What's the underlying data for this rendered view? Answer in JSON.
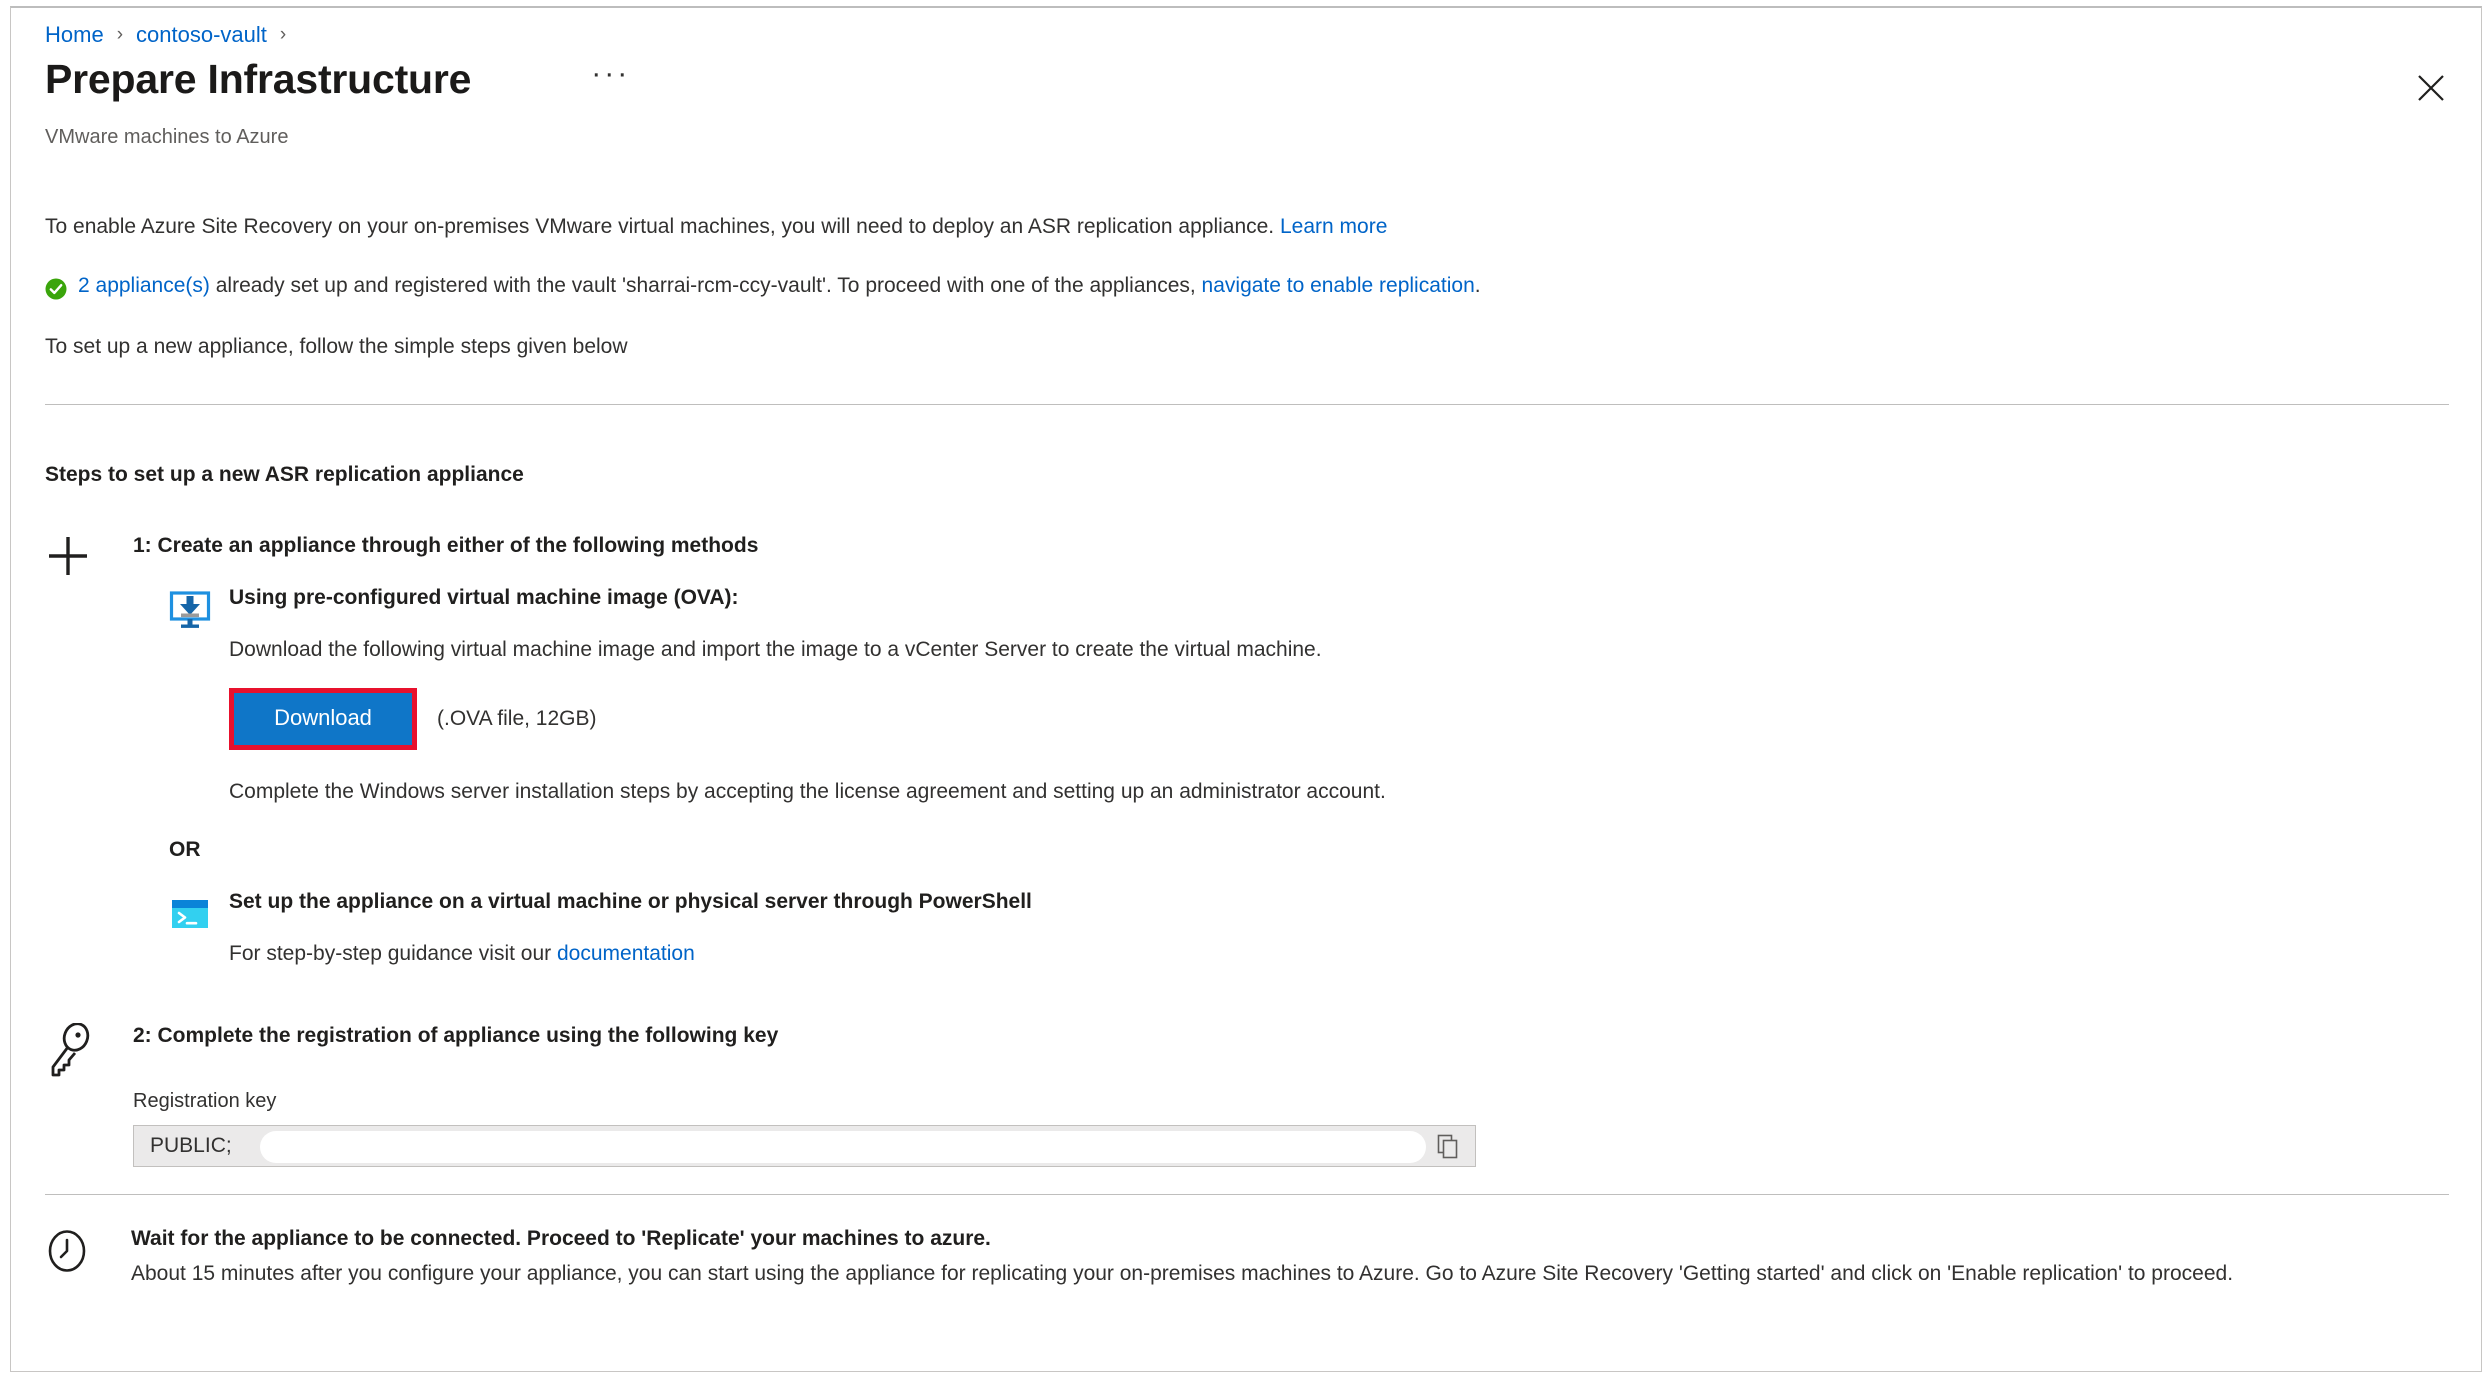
{
  "breadcrumb": {
    "items": [
      {
        "label": "Home"
      },
      {
        "label": "contoso-vault"
      }
    ],
    "separator": "›"
  },
  "header": {
    "title": "Prepare Infrastructure",
    "subtitle": "VMware machines to Azure",
    "more_label": "···",
    "close_label": "",
    "more_icon": "ellipsis-icon",
    "close_icon": "close-icon"
  },
  "intro": {
    "line1_pre": "To enable Azure Site Recovery on your on-premises VMware virtual machines, you will need to deploy an ASR replication appliance. ",
    "line1_link": "Learn more",
    "status_icon": "success-check-icon",
    "status_link1": "2 appliance(s)",
    "status_mid": " already set up and registered with the vault 'sharrai-rcm-ccy-vault'. To proceed with one of the appliances, ",
    "status_link2": "navigate to enable replication",
    "status_end": ".",
    "hint": "To set up a new appliance, follow the simple steps given below"
  },
  "steps": {
    "heading": "Steps to set up a new ASR replication appliance",
    "step1": {
      "icon": "plus-icon",
      "title": "1: Create an appliance through either of the following methods",
      "ova": {
        "icon": "monitor-download-icon",
        "title": "Using pre-configured virtual machine image (OVA):",
        "text": "Download the following virtual machine image and import the image to a vCenter Server to create the virtual machine.",
        "download_label": "Download",
        "download_note": "(.OVA file, 12GB)",
        "post_text": "Complete the Windows server installation steps by accepting the license agreement and setting up an administrator account.",
        "highlight_color": "#e8112d",
        "button_color": "#0f76c8"
      },
      "or_label": "OR",
      "powershell": {
        "icon": "terminal-icon",
        "title": "Set up the appliance on a virtual machine or physical server through PowerShell",
        "text_pre": "For step-by-step guidance visit our ",
        "text_link": "documentation"
      }
    },
    "step2": {
      "icon": "key-icon",
      "title": "2: Complete the registration of appliance using the following key",
      "field_label": "Registration key",
      "field_value": "PUBLIC;",
      "field_placeholder": "Registration key",
      "copy_icon": "copy-icon",
      "copy_label": ""
    }
  },
  "footer": {
    "icon": "clock-icon",
    "title": "Wait for the appliance to be connected. Proceed to 'Replicate' your machines to azure.",
    "text": "About 15 minutes after you configure your appliance, you can start using the appliance for replicating your on-premises machines to Azure. Go to Azure Site Recovery 'Getting started' and click on 'Enable replication' to proceed."
  },
  "colors": {
    "link": "#0064c8",
    "accent": "#0f76c8",
    "success": "#3aa50b",
    "highlight": "#e8112d"
  }
}
